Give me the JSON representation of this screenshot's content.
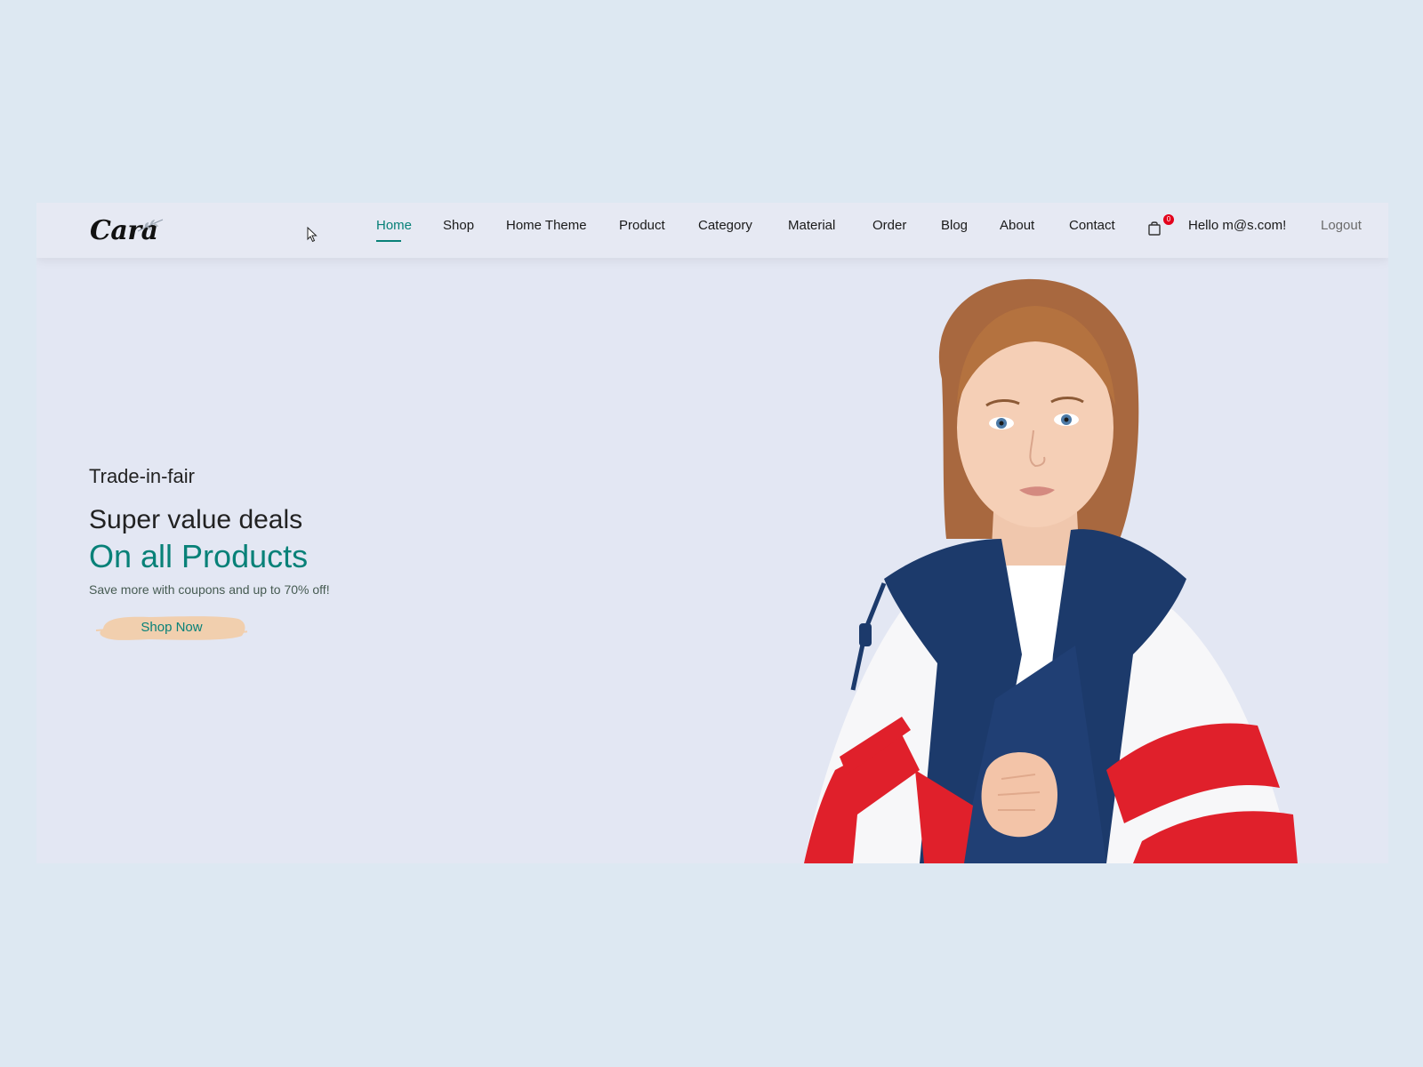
{
  "brand": {
    "name": "Cara"
  },
  "nav": {
    "items": [
      {
        "label": "Home",
        "active": true
      },
      {
        "label": "Shop",
        "active": false
      },
      {
        "label": "Home Theme",
        "active": false
      },
      {
        "label": "Product",
        "active": false
      },
      {
        "label": "Category",
        "active": false
      },
      {
        "label": "Material",
        "active": false
      },
      {
        "label": "Order",
        "active": false
      },
      {
        "label": "Blog",
        "active": false
      },
      {
        "label": "About",
        "active": false
      },
      {
        "label": "Contact",
        "active": false
      }
    ],
    "cart": {
      "icon": "shopping-bag-icon",
      "count": "0"
    },
    "greeting": "Hello m@s.com!",
    "logout_label": "Logout"
  },
  "hero": {
    "eyebrow": "Trade-in-fair",
    "headline": "Super value deals",
    "subheadline": "On all Products",
    "tagline": "Save more with coupons and up to 70% off!",
    "cta_label": "Shop Now",
    "image": "model-in-windbreaker-jacket"
  },
  "colors": {
    "page_bg": "#dde8f2",
    "frame_bg": "#e3e7f3",
    "accent": "#088178",
    "button_bg": "#f1cfae",
    "badge": "#e3001b"
  }
}
